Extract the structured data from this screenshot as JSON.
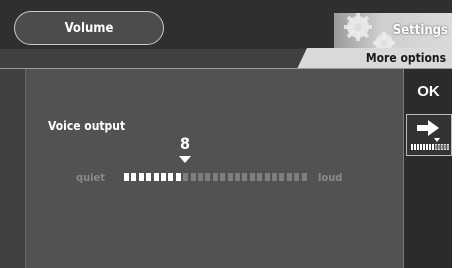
{
  "header": {
    "volume_tab_label": "Volume",
    "settings_tab_label": "Settings",
    "more_options_label": "More options"
  },
  "side_buttons": {
    "ok_label": "OK"
  },
  "voice_output": {
    "title": "Voice output",
    "value": "8",
    "level": 8,
    "max": 25,
    "min_label": "quiet",
    "max_label": "loud"
  },
  "colors": {
    "scale_active": "#ffffff",
    "scale_inactive": "#7e7e7e"
  }
}
